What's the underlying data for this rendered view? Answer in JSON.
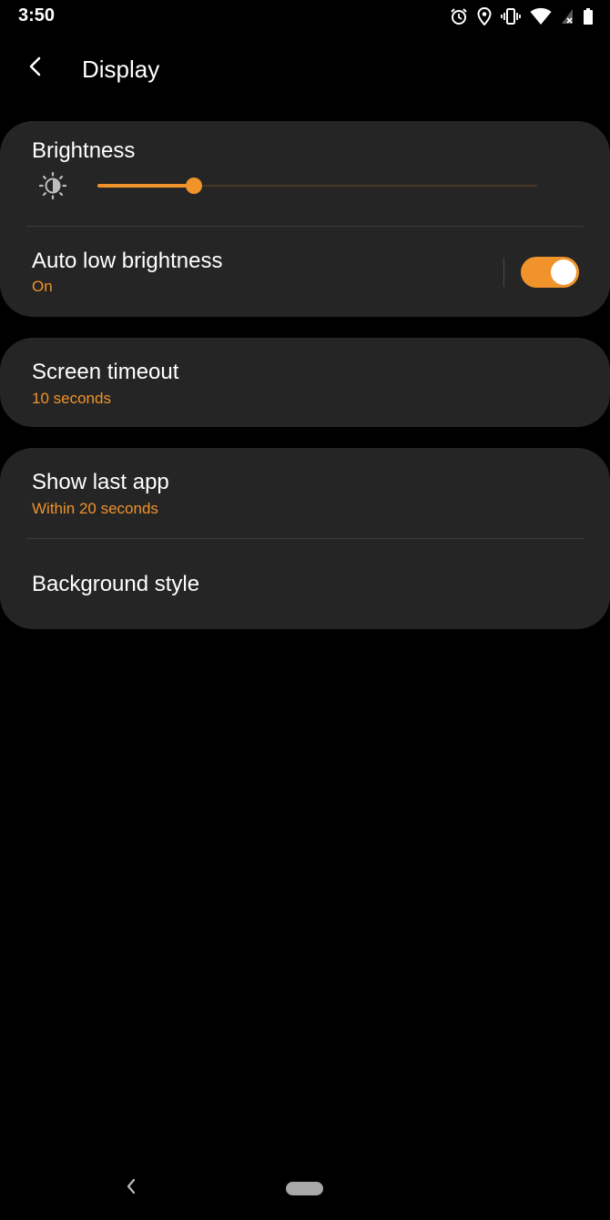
{
  "status_bar": {
    "time": "3:50",
    "icons": [
      "alarm-icon",
      "location-icon",
      "vibrate-icon",
      "wifi-icon",
      "signal-no-service-icon",
      "battery-icon"
    ]
  },
  "header": {
    "title": "Display",
    "back_icon": "back-arrow-icon"
  },
  "brightness": {
    "title": "Brightness",
    "icon": "brightness-sun-icon",
    "level": 0.22
  },
  "auto_low_brightness": {
    "title": "Auto low brightness",
    "status": "On",
    "enabled": true
  },
  "screen_timeout": {
    "title": "Screen timeout",
    "value": "10 seconds"
  },
  "show_last_app": {
    "title": "Show last app",
    "value": "Within 20 seconds"
  },
  "background_style": {
    "title": "Background style"
  },
  "nav_bar": {
    "back_icon": "nav-back-icon",
    "home_icon": "nav-home-pill"
  },
  "colors": {
    "accent": "#f0932a",
    "card": "#252525",
    "background": "#000000",
    "text": "#ffffff"
  }
}
